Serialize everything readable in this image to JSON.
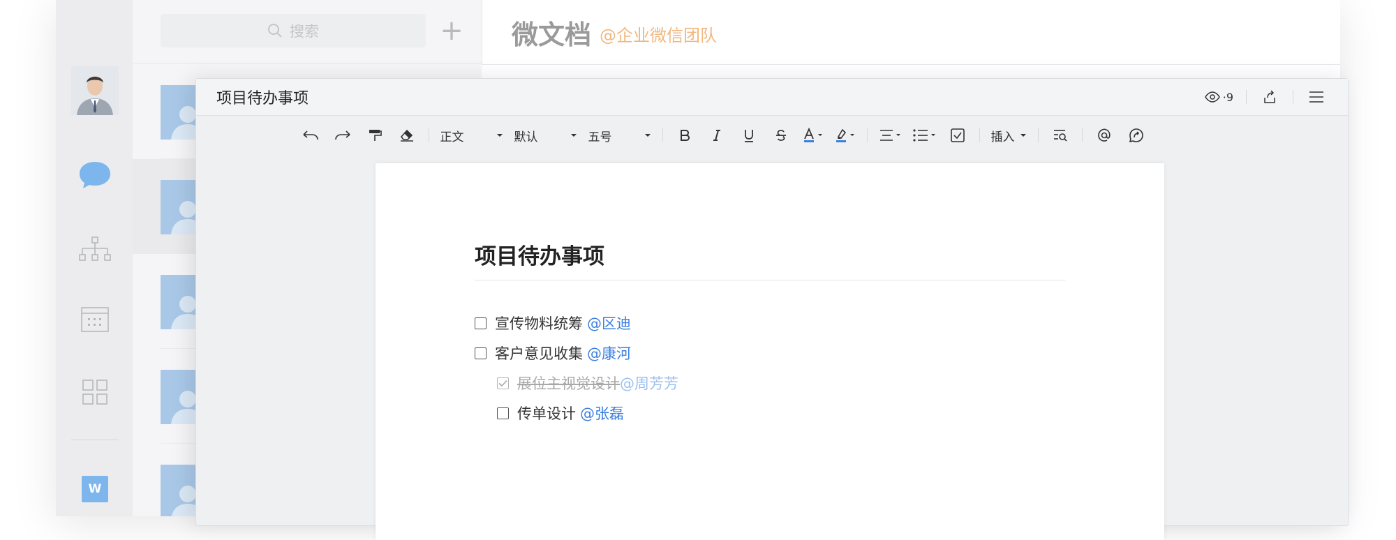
{
  "sidebar": {
    "icons": [
      "chat-icon",
      "org-chart-icon",
      "calendar-icon",
      "apps-grid-icon"
    ],
    "bottom_app_letter": "W"
  },
  "session_list": {
    "search_placeholder": "搜索",
    "add_label": "+"
  },
  "header": {
    "title": "微文档",
    "subtitle": "@企业微信团队"
  },
  "doc": {
    "window_title": "项目待办事项",
    "viewers_label": "·9",
    "toolbar": {
      "style": "正文",
      "font": "默认",
      "size": "五号",
      "insert": "插入"
    },
    "heading": "项目待办事项",
    "todos": [
      {
        "text": "宣传物料统筹",
        "mention": "@区迪",
        "done": false
      },
      {
        "text": "客户意见收集",
        "mention": "@康河",
        "done": false
      },
      {
        "text": "展位主视觉设计",
        "mention": "@周芳芳",
        "done": true
      },
      {
        "text": "传单设计",
        "mention": "@张磊",
        "done": false
      }
    ]
  },
  "colors": {
    "accent": "#3a7fe0",
    "header_subtitle": "#f3b77e",
    "chat_icon": "#7db6ec"
  }
}
